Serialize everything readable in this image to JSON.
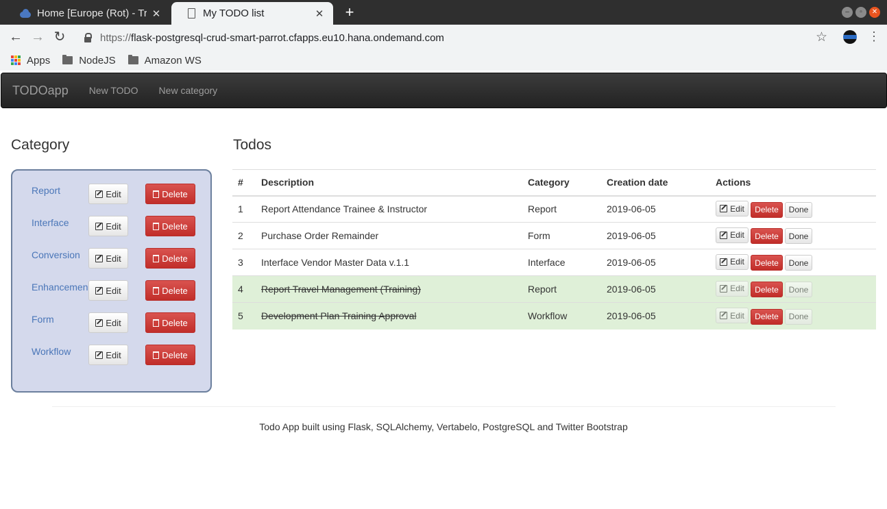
{
  "browser": {
    "tabs": [
      {
        "title": "Home [Europe (Rot) - Trial]",
        "icon": "cloud-icon",
        "active": false
      },
      {
        "title": "My TODO list",
        "icon": "page-icon",
        "active": true
      }
    ],
    "url_scheme": "https://",
    "url_rest": "flask-postgresql-crud-smart-parrot.cfapps.eu10.hana.ondemand.com",
    "bookmarks": [
      {
        "label": "Apps",
        "icon": "apps-icon"
      },
      {
        "label": "NodeJS",
        "icon": "folder-icon"
      },
      {
        "label": "Amazon WS",
        "icon": "folder-icon"
      }
    ]
  },
  "navbar": {
    "brand": "TODOapp",
    "links": [
      "New TODO",
      "New category"
    ]
  },
  "category": {
    "heading": "Category",
    "edit_label": "Edit",
    "delete_label": "Delete",
    "items": [
      "Report",
      "Interface",
      "Conversion",
      "Enhancement",
      "Form",
      "Workflow"
    ]
  },
  "todos": {
    "heading": "Todos",
    "columns": [
      "#",
      "Description",
      "Category",
      "Creation date",
      "Actions"
    ],
    "edit_label": "Edit",
    "delete_label": "Delete",
    "done_label": "Done",
    "rows": [
      {
        "num": "1",
        "description": "Report Attendance Trainee & Instructor",
        "category": "Report",
        "date": "2019-06-05",
        "done": false
      },
      {
        "num": "2",
        "description": "Purchase Order Remainder",
        "category": "Form",
        "date": "2019-06-05",
        "done": false
      },
      {
        "num": "3",
        "description": "Interface Vendor Master Data v.1.1",
        "category": "Interface",
        "date": "2019-06-05",
        "done": false
      },
      {
        "num": "4",
        "description": "Report Travel Management (Training)",
        "category": "Report",
        "date": "2019-06-05",
        "done": true
      },
      {
        "num": "5",
        "description": "Development Plan Training Approval",
        "category": "Workflow",
        "date": "2019-06-05",
        "done": true
      }
    ]
  },
  "footer": {
    "text": "Todo App built using Flask, SQLAlchemy, Vertabelo, PostgreSQL and Twitter Bootstrap"
  },
  "colors": {
    "category_panel_bg": "#d4d9ec",
    "done_row_bg": "#dff0d8",
    "danger": "#d9534f",
    "link": "#4a76b8"
  }
}
